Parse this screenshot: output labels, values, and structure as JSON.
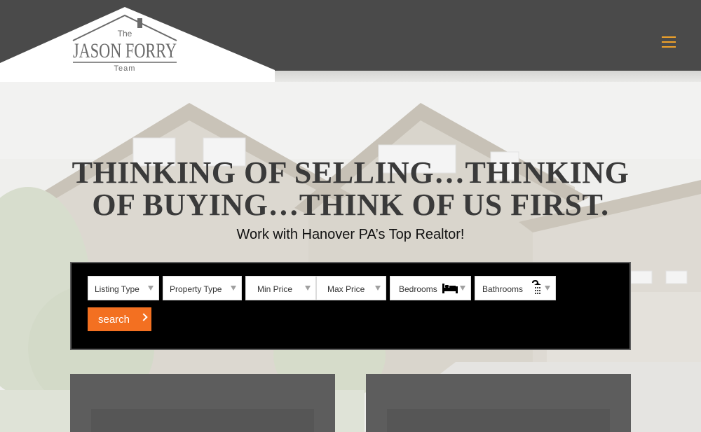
{
  "header": {
    "logo_top": "The",
    "logo_main": "JASON FORRY",
    "logo_bottom": "Team",
    "menu_icon": "hamburger-icon",
    "accent_color": "#f0a22a"
  },
  "hero": {
    "title_line1": "THINKING OF SELLING…THINKING",
    "title_line2": "OF BUYING…THINK OF US FIRST.",
    "subtitle": "Work with Hanover PA’s Top Realtor!"
  },
  "search": {
    "fields": [
      {
        "label": "Listing Type"
      },
      {
        "label": "Property Type"
      },
      {
        "label": "Min Price"
      },
      {
        "label": "Max Price"
      },
      {
        "label": "Bedrooms",
        "icon": "bed-icon"
      },
      {
        "label": "Bathrooms",
        "icon": "shower-icon"
      }
    ],
    "button_label": "search",
    "button_color": "#f37021"
  }
}
